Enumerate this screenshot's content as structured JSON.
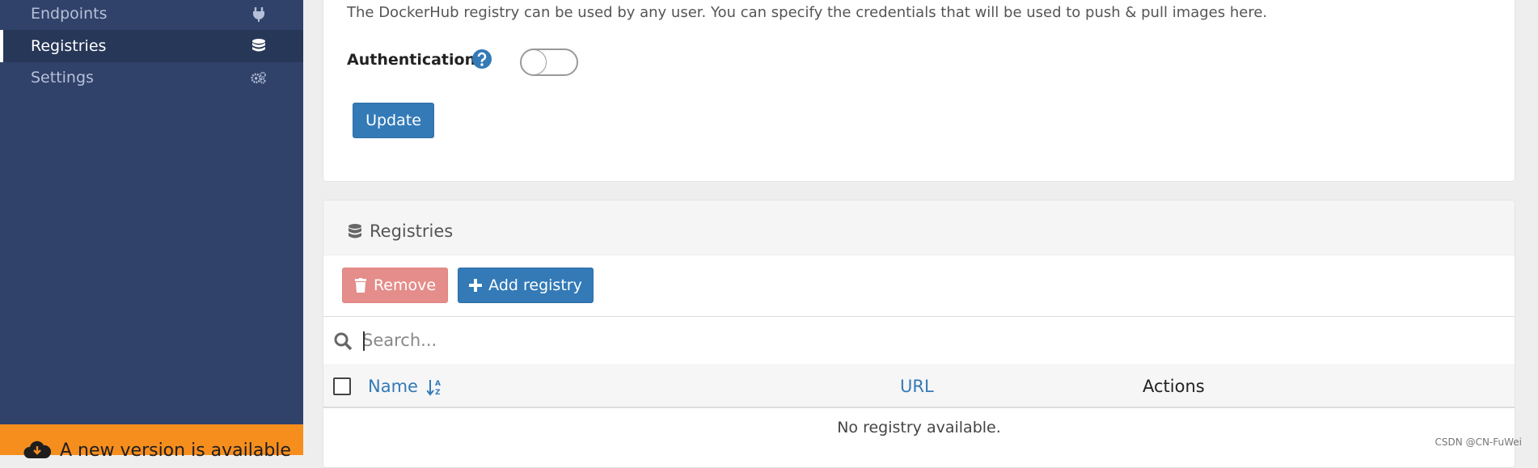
{
  "sidebar": {
    "items": [
      {
        "label": "Endpoints",
        "icon": "plug-icon",
        "active": false
      },
      {
        "label": "Registries",
        "icon": "database-icon",
        "active": true
      },
      {
        "label": "Settings",
        "icon": "cogs-icon",
        "active": false
      }
    ],
    "update_banner": {
      "text": "A new version is available",
      "icon": "cloud-download-icon",
      "color": "#f68e1e"
    }
  },
  "dockerhub": {
    "description": "The DockerHub registry can be used by any user. You can specify the credentials that will be used to push & pull images here.",
    "auth_label": "Authentication",
    "auth_enabled": false,
    "update_label": "Update"
  },
  "registries": {
    "title": "Registries",
    "remove_label": "Remove",
    "add_label": "Add registry",
    "search_placeholder": "Search...",
    "columns": {
      "name": "Name",
      "url": "URL",
      "actions": "Actions"
    },
    "empty_message": "No registry available."
  },
  "watermark": "CSDN @CN-FuWei",
  "colors": {
    "sidebar": "#30426a",
    "primary": "#337ab7",
    "danger": "#e48d8a"
  }
}
